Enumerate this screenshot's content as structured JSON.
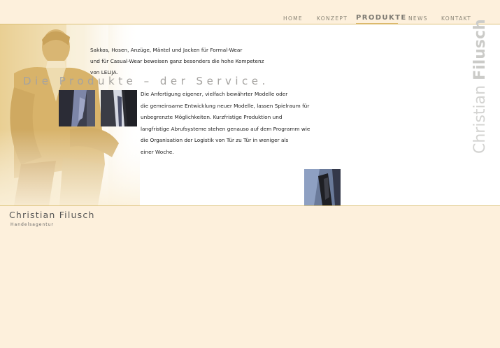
{
  "nav": {
    "items": [
      {
        "label": "HOME"
      },
      {
        "label": "KONZEPT"
      },
      {
        "label": "PRODUKTE",
        "active": true
      },
      {
        "label": "NEWS"
      },
      {
        "label": "KONTAKT"
      }
    ]
  },
  "content": {
    "intro_lines": [
      "Sakkos, Hosen, Anzüge, Mäntel und Jacken für Formal-Wear",
      "und für Casual-Wear beweisen ganz besonders die hohe Kompetenz",
      "von LELIJA."
    ],
    "headline": "Die Produkte – der Service.",
    "body_lines": [
      "Die Anfertigung eigener, vielfach bewährter Modelle oder",
      "die gemeinsame Entwicklung neuer Modelle, lassen Spielraum für",
      "unbegrenzte Möglichkeiten. Kurzfristige Produktion und",
      "langfristige Abrufsysteme stehen genauso auf dem Programm wie",
      "die Organisation der Logistik von Tür zu Tür in weniger als",
      "einer Woche."
    ],
    "vertical_brand": {
      "first": "Christian ",
      "last": "Filusch"
    }
  },
  "footer": {
    "brand_name": "Christian Filusch",
    "brand_sub": "Handelsagentur"
  },
  "colors": {
    "background": "#fdf0dc",
    "accent_rule": "#dcc27a",
    "nav_text": "#8a8577"
  }
}
